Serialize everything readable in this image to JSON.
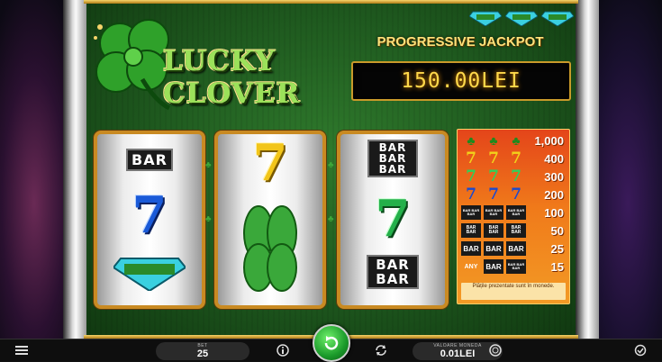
{
  "game": {
    "logo_line1": "LUCKY",
    "logo_line2": "CLOVER",
    "jackpot_title": "PROGRESSIVE JACKPOT",
    "jackpot_value": "150.00LEI"
  },
  "reels": [
    {
      "symbols": [
        "BAR",
        "7",
        "CLOVER & DIAMOND"
      ]
    },
    {
      "symbols": [
        "7",
        "clover"
      ]
    },
    {
      "symbols": [
        "BAR BAR BAR",
        "7",
        "BAR BAR"
      ]
    }
  ],
  "paytable": {
    "rows": [
      {
        "symbols": [
          "clover",
          "clover",
          "clover"
        ],
        "value": "1,000"
      },
      {
        "symbols": [
          "7",
          "7",
          "7"
        ],
        "color": "gold",
        "value": "400"
      },
      {
        "symbols": [
          "7",
          "7",
          "7"
        ],
        "color": "green",
        "value": "300"
      },
      {
        "symbols": [
          "7",
          "7",
          "7"
        ],
        "color": "blue",
        "value": "200"
      },
      {
        "symbols": [
          "BAR BAR BAR",
          "BAR BAR BAR",
          "BAR BAR BAR"
        ],
        "value": "100"
      },
      {
        "symbols": [
          "BAR BAR",
          "BAR BAR",
          "BAR BAR"
        ],
        "value": "50"
      },
      {
        "symbols": [
          "BAR",
          "BAR",
          "BAR"
        ],
        "value": "25"
      },
      {
        "symbols": [
          "ANY",
          "BAR",
          "BAR BAR BAR"
        ],
        "value": "15"
      }
    ],
    "note": "Plățile prezentate sunt în monede."
  },
  "controls": {
    "bet_label": "BET",
    "bet_value": "25",
    "coin_label": "VALOARE MONEDA",
    "coin_value": "0.01LEI"
  },
  "icons": [
    "menu-icon",
    "info-icon",
    "spin-icon",
    "autoplay-icon",
    "coin-icon",
    "settings-icon"
  ],
  "colors": {
    "felt": "#1f5a1f",
    "gold": "#c98a22",
    "jackpot_digits": "#ffd84a",
    "spin_green": "#1a9a2a"
  }
}
